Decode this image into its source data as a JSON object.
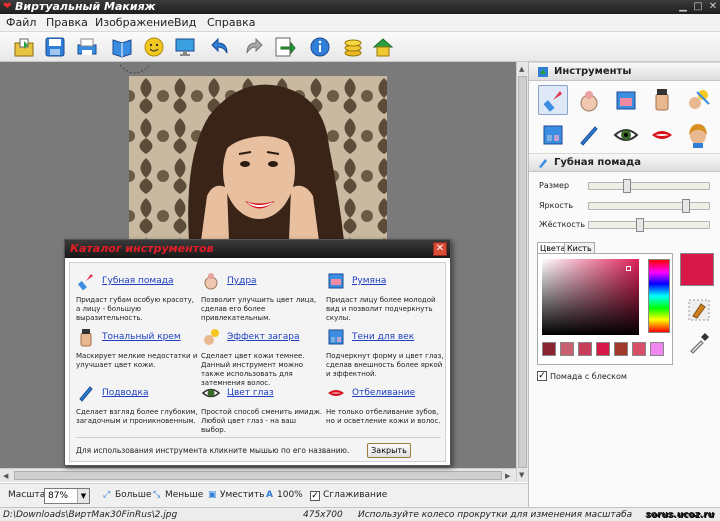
{
  "window": {
    "title": "Виртуальный Макияж"
  },
  "menu": [
    "Файл",
    "Правка",
    "Изображение",
    "Вид",
    "Справка"
  ],
  "toolbar_icons": [
    "open-icon",
    "save-icon",
    "print-icon",
    "book-icon",
    "smile-icon",
    "monitor-icon",
    "undo-icon",
    "redo-icon",
    "export-icon",
    "info-icon",
    "coins-icon",
    "home-icon"
  ],
  "zoom": {
    "label": "Масштаб",
    "value": "87%",
    "bigger": "Больше",
    "smaller": "Меньше",
    "fit": "Уместить",
    "hundred": "100%",
    "smooth": "Сглаживание"
  },
  "status": {
    "path": "D:\\Downloads\\ВиртМак30FinRus\\2.jpg",
    "size": "475x700",
    "hint": "Используйте колесо прокрутки для изменения масштаба",
    "watermark": "sorus.ucoz.ru"
  },
  "panel": {
    "tools_title": "Инструменты",
    "tool_title": "Губная помада",
    "sliders": [
      {
        "label": "Размер",
        "value": 0.3
      },
      {
        "label": "Яркость",
        "value": 0.83
      },
      {
        "label": "Жёсткость",
        "value": 0.42
      }
    ],
    "tabs": [
      "Цвета",
      "Кисть"
    ],
    "selected_color": "#d81848",
    "swatches": [
      "#8a2434",
      "#c86070",
      "#c83c5c",
      "#d81848",
      "#a0382c",
      "#d85068",
      "#f088f0"
    ],
    "gloss_label": "Помада с блеском",
    "gloss_checked": true
  },
  "dialog": {
    "title": "Каталог инструментов",
    "items": [
      {
        "name": "Губная помада",
        "desc": "Придаст губам особую красоту, а лицу - большую выразительность."
      },
      {
        "name": "Пудра",
        "desc": "Позволит улучшить цвет лица, сделав его более привлекательным."
      },
      {
        "name": "Румяна",
        "desc": "Придаст лицу более молодой вид и позволит подчеркнуть скулы."
      },
      {
        "name": "Тональный крем",
        "desc": "Маскирует мелкие недостатки и улучшает цвет кожи."
      },
      {
        "name": "Эффект загара",
        "desc": "Сделает цвет кожи темнее. Данный инструмент можно также использовать для затемнения волос."
      },
      {
        "name": "Тени для век",
        "desc": "Подчеркнут форму и цвет глаз, сделав внешность более яркой и эффектной."
      },
      {
        "name": "Подводка",
        "desc": "Сделает взгляд более глубоким, загадочным и проникновенным."
      },
      {
        "name": "Цвет глаз",
        "desc": "Простой способ сменить имидж. Любой цвет глаз - на ваш выбор."
      },
      {
        "name": "Отбеливание",
        "desc": "Не только отбеливание зубов, но и осветление кожи и волос."
      }
    ],
    "footer": "Для использования инструмента кликните мышью по его названию.",
    "close_button": "Закрыть"
  }
}
